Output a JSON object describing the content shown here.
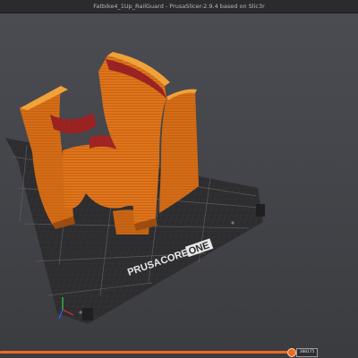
{
  "window": {
    "title": "Fatbike4_1Up_RailGuard - PrusaSlicer-2.9.4 based on Slic3r"
  },
  "bed": {
    "logo_left": "PRUSA",
    "logo_mid": "CORE",
    "logo_right": "ONE"
  },
  "layer_slider": {
    "readout": "300175",
    "position_fraction": 0.82
  },
  "colors": {
    "accent": "#ed6b21",
    "model": "#e0741a",
    "bed": "#2d2d2f"
  }
}
